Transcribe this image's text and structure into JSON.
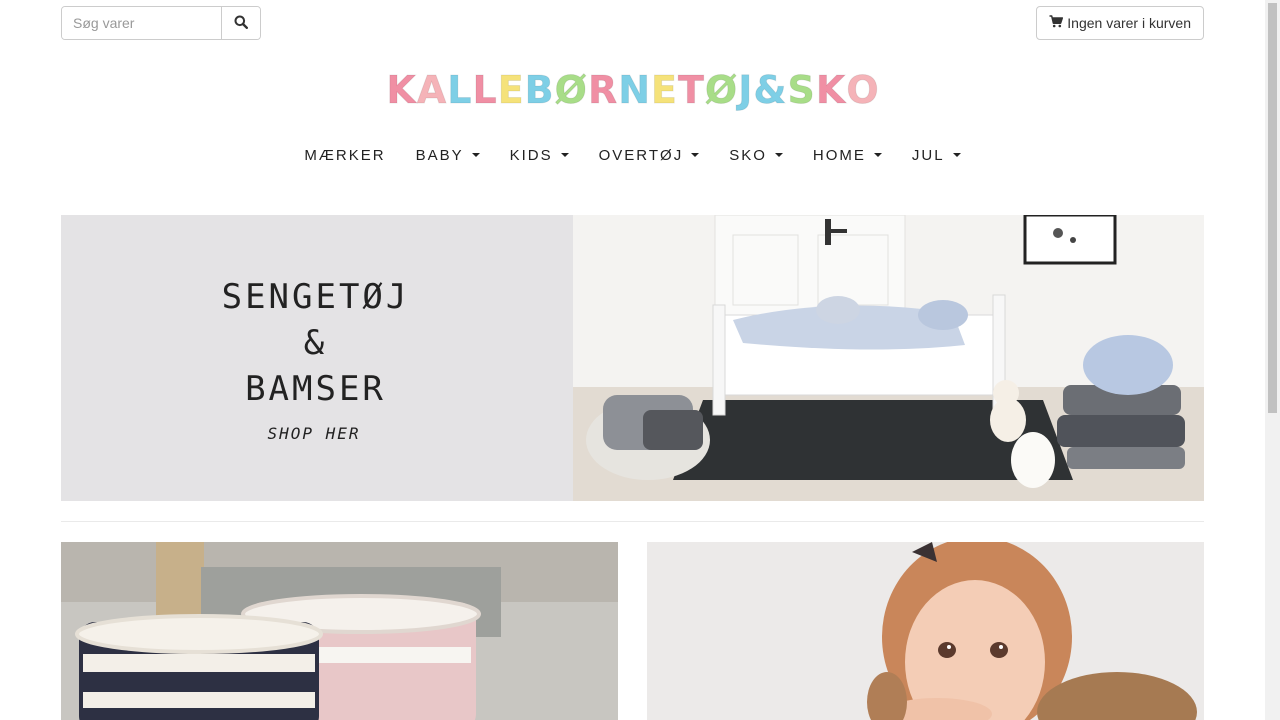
{
  "search": {
    "placeholder": "Søg varer",
    "icon": "search-icon"
  },
  "cart": {
    "label": "Ingen varer i kurven",
    "icon": "cart-icon"
  },
  "logo": {
    "letters": [
      {
        "ch": "K",
        "color": "#f08fa4"
      },
      {
        "ch": "A",
        "color": "#f5b3b8"
      },
      {
        "ch": "L",
        "color": "#7ecfe6"
      },
      {
        "ch": "L",
        "color": "#f08fa4"
      },
      {
        "ch": "E",
        "color": "#f5e27a"
      },
      {
        "ch": " ",
        "color": "#000000"
      },
      {
        "ch": "B",
        "color": "#7ecfe6"
      },
      {
        "ch": "Ø",
        "color": "#a8dd88"
      },
      {
        "ch": "R",
        "color": "#f08fa4"
      },
      {
        "ch": "N",
        "color": "#7ecfe6"
      },
      {
        "ch": "E",
        "color": "#f5e27a"
      },
      {
        "ch": "T",
        "color": "#f08fa4"
      },
      {
        "ch": "Ø",
        "color": "#a8dd88"
      },
      {
        "ch": "J",
        "color": "#7ecfe6"
      },
      {
        "ch": " ",
        "color": "#000000"
      },
      {
        "ch": "&",
        "color": "#7ecfe6"
      },
      {
        "ch": " ",
        "color": "#000000"
      },
      {
        "ch": "S",
        "color": "#a8dd88"
      },
      {
        "ch": "K",
        "color": "#f08fa4"
      },
      {
        "ch": "O",
        "color": "#f5b3b8"
      }
    ]
  },
  "nav": [
    {
      "label": "MÆRKER",
      "dropdown": false
    },
    {
      "label": "BABY",
      "dropdown": true
    },
    {
      "label": "KIDS",
      "dropdown": true
    },
    {
      "label": "OVERTØJ",
      "dropdown": true
    },
    {
      "label": "SKO",
      "dropdown": true
    },
    {
      "label": "HOME",
      "dropdown": true
    },
    {
      "label": "JUL",
      "dropdown": true
    }
  ],
  "banner": {
    "line1": "SENGETØJ",
    "line2": "&",
    "line3": "BAMSER",
    "cta": "SHOP HER",
    "bg_color": "#e4e3e5"
  }
}
